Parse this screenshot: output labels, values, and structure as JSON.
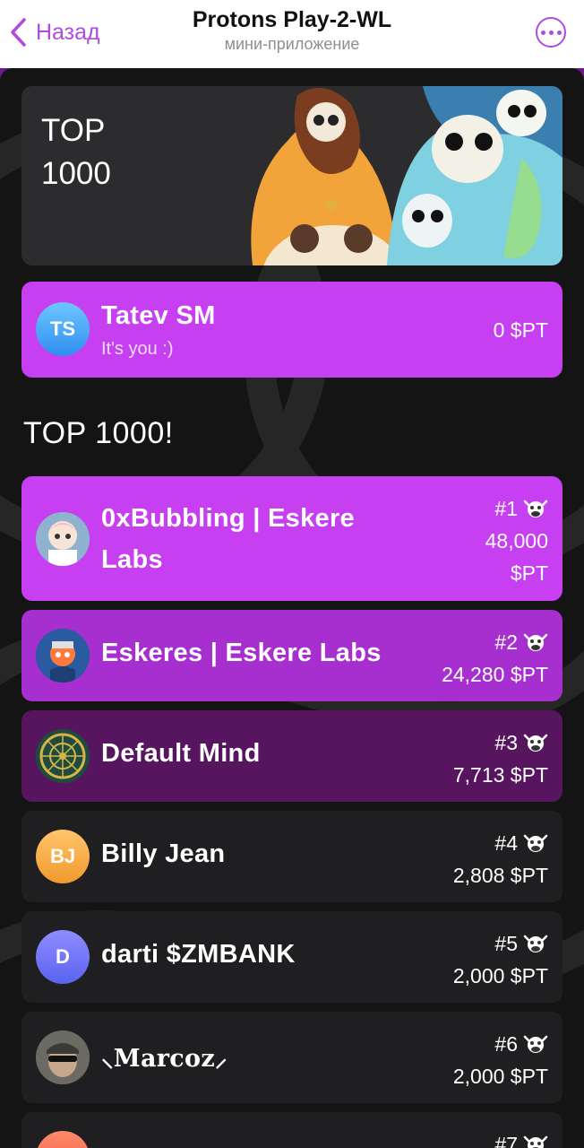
{
  "header": {
    "back_label": "Назад",
    "title": "Protons Play-2-WL",
    "subtitle": "мини-приложение"
  },
  "banner": {
    "line1": "TOP",
    "line2": "1000"
  },
  "me": {
    "initials": "TS",
    "name": "Tatev SM",
    "caption": "It's you :)",
    "score": "0 $PT"
  },
  "section_title": "TOP 1000!",
  "leaders": [
    {
      "rank": "#1",
      "name": "0xBubbling | Eskere Labs",
      "score_line1": "48,000",
      "score_line2": "$PT",
      "avatar": "photo"
    },
    {
      "rank": "#2",
      "name": "Eskeres | Eskere Labs",
      "score": "24,280 $PT",
      "avatar": "photo"
    },
    {
      "rank": "#3",
      "name": "Default Mind",
      "score": "7,713 $PT",
      "avatar": "photo"
    },
    {
      "rank": "#4",
      "name": "Billy Jean",
      "score": "2,808 $PT",
      "initials": "BJ"
    },
    {
      "rank": "#5",
      "name": "darti $ZMBANK",
      "score": "2,000 $PT",
      "initials": "D"
    },
    {
      "rank": "#6",
      "name": "⸜𝐌𝐚𝐫𝐜𝐨𝐳⸝",
      "score": "2,000 $PT",
      "avatar": "photo"
    },
    {
      "rank": "#7",
      "name": "",
      "score": "",
      "initials": ""
    }
  ],
  "colors": {
    "accent": "#b04be0",
    "rank1": "#c63ff0",
    "rank2": "#a72fd0",
    "rank3": "#56155e",
    "card": "#1f1f21",
    "background": "#141414"
  },
  "icons": {
    "back": "chevron-left-icon",
    "more": "more-dots-icon",
    "rank": "cow-icon"
  }
}
